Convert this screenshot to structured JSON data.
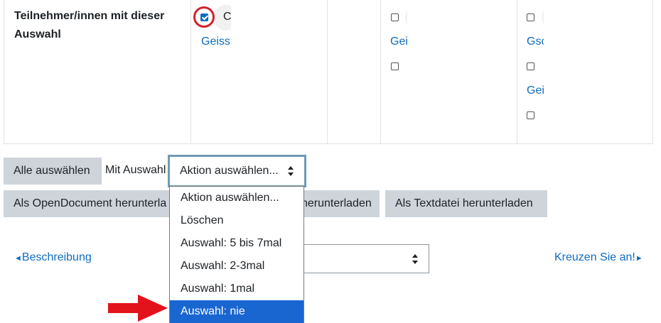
{
  "table": {
    "row_label": "Teilnehmer/innen mit dieser Auswahl",
    "col1": {
      "name_initial": "C",
      "link": "Geissi"
    },
    "col3": {
      "link": "Gei"
    },
    "col4": {
      "link_1": "Gsc",
      "link_2": "Gei"
    }
  },
  "toolbar": {
    "select_all": "Alle auswählen",
    "with_selection": "Mit Auswahl",
    "action_select_value": "Aktion auswählen..."
  },
  "downloads": {
    "odf": "Als OpenDocument herunterla",
    "excel_tail": "herunterladen",
    "text": "Als Textdatei herunterladen"
  },
  "dropdown": {
    "options": [
      "Aktion auswählen...",
      "Löschen",
      "Auswahl: 5 bis 7mal",
      "Auswahl: 2-3mal",
      "Auswahl: 1mal",
      "Auswahl: nie"
    ],
    "selected_index": 5
  },
  "nav": {
    "prev": "Beschreibung",
    "next": "Kreuzen Sie an!"
  },
  "colors": {
    "accent": "#0f6cbf",
    "highlight": "#1a66d1",
    "annotation": "#d2212b"
  }
}
